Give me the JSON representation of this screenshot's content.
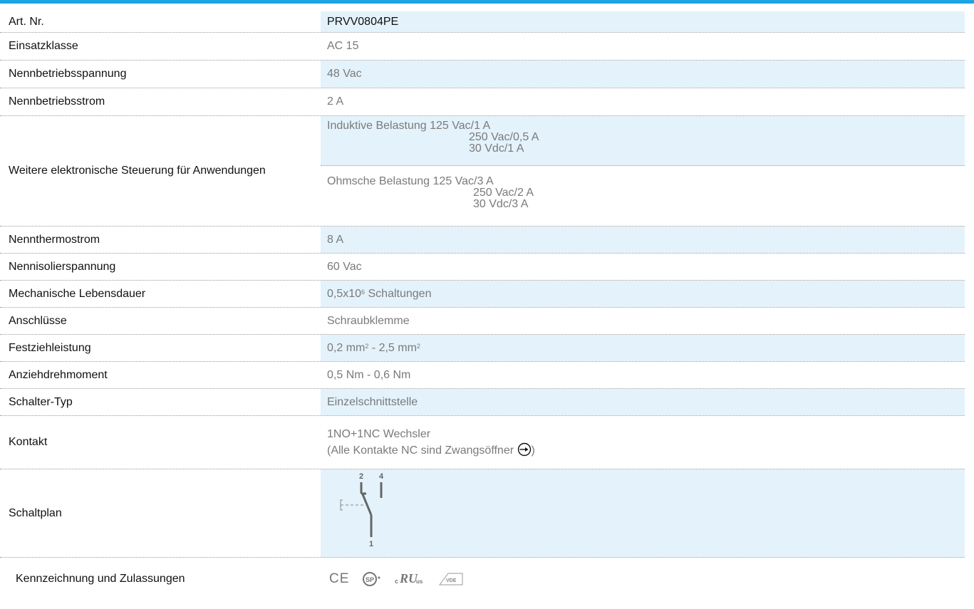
{
  "rows": [
    {
      "label": "Art. Nr.",
      "value": "PRVV0804PE"
    },
    {
      "label": "Einsatzklasse",
      "value": "AC 15"
    },
    {
      "label": "Nennbetriebsspannung",
      "value": "48 Vac"
    },
    {
      "label": "Nennbetriebsstrom",
      "value": "2 A"
    },
    {
      "label": "Weitere elektronische Steuerung für Anwendungen",
      "induktiv": {
        "l1": "Induktive Belastung 125 Vac/1 A",
        "l2": "250 Vac/0,5 A",
        "l3": "30 Vdc/1 A"
      },
      "ohmsch": {
        "l1": "Ohmsche Belastung 125 Vac/3 A",
        "l2": "250 Vac/2 A",
        "l3": "30 Vdc/3 A"
      }
    },
    {
      "label": "Nennthermostrom",
      "value": "8 A"
    },
    {
      "label": "Nennisolierspannung",
      "value": "60 Vac"
    },
    {
      "label": "Mechanische Lebensdauer",
      "value_pre": "0,5x10",
      "value_sup": "6",
      "value_post": " Schaltungen"
    },
    {
      "label": "Anschlüsse",
      "value": "Schraubklemme"
    },
    {
      "label": "Festziehleistung",
      "value_pre": "0,2 mm",
      "value_sup1": "2",
      "value_mid": " - 2,5 mm",
      "value_sup2": "2"
    },
    {
      "label": "Anziehdrehmoment",
      "value": "0,5 Nm - 0,6 Nm"
    },
    {
      "label": "Schalter-Typ",
      "value": "Einzelschnittstelle"
    },
    {
      "label": "Kontakt",
      "line1": "1NO+1NC Wechsler",
      "line2": "(Alle Kontakte NC sind Zwangsöffner",
      "line2_end": ")"
    },
    {
      "label": "Schaltplan",
      "terminal_top_left": "2",
      "terminal_top_right": "4",
      "terminal_bottom": "1"
    },
    {
      "label": "Kennzeichnung und Zulassungen",
      "logo_ce": "CE",
      "logo_csa": "SP",
      "logo_ul_c": "c",
      "logo_ul": "RU",
      "logo_ul_us": "us",
      "logo_vde": "VDE"
    }
  ],
  "colors": {
    "accent": "#1ca4e3",
    "row_blue": "#e4f2fb",
    "value_gray": "#7a7a7a"
  }
}
